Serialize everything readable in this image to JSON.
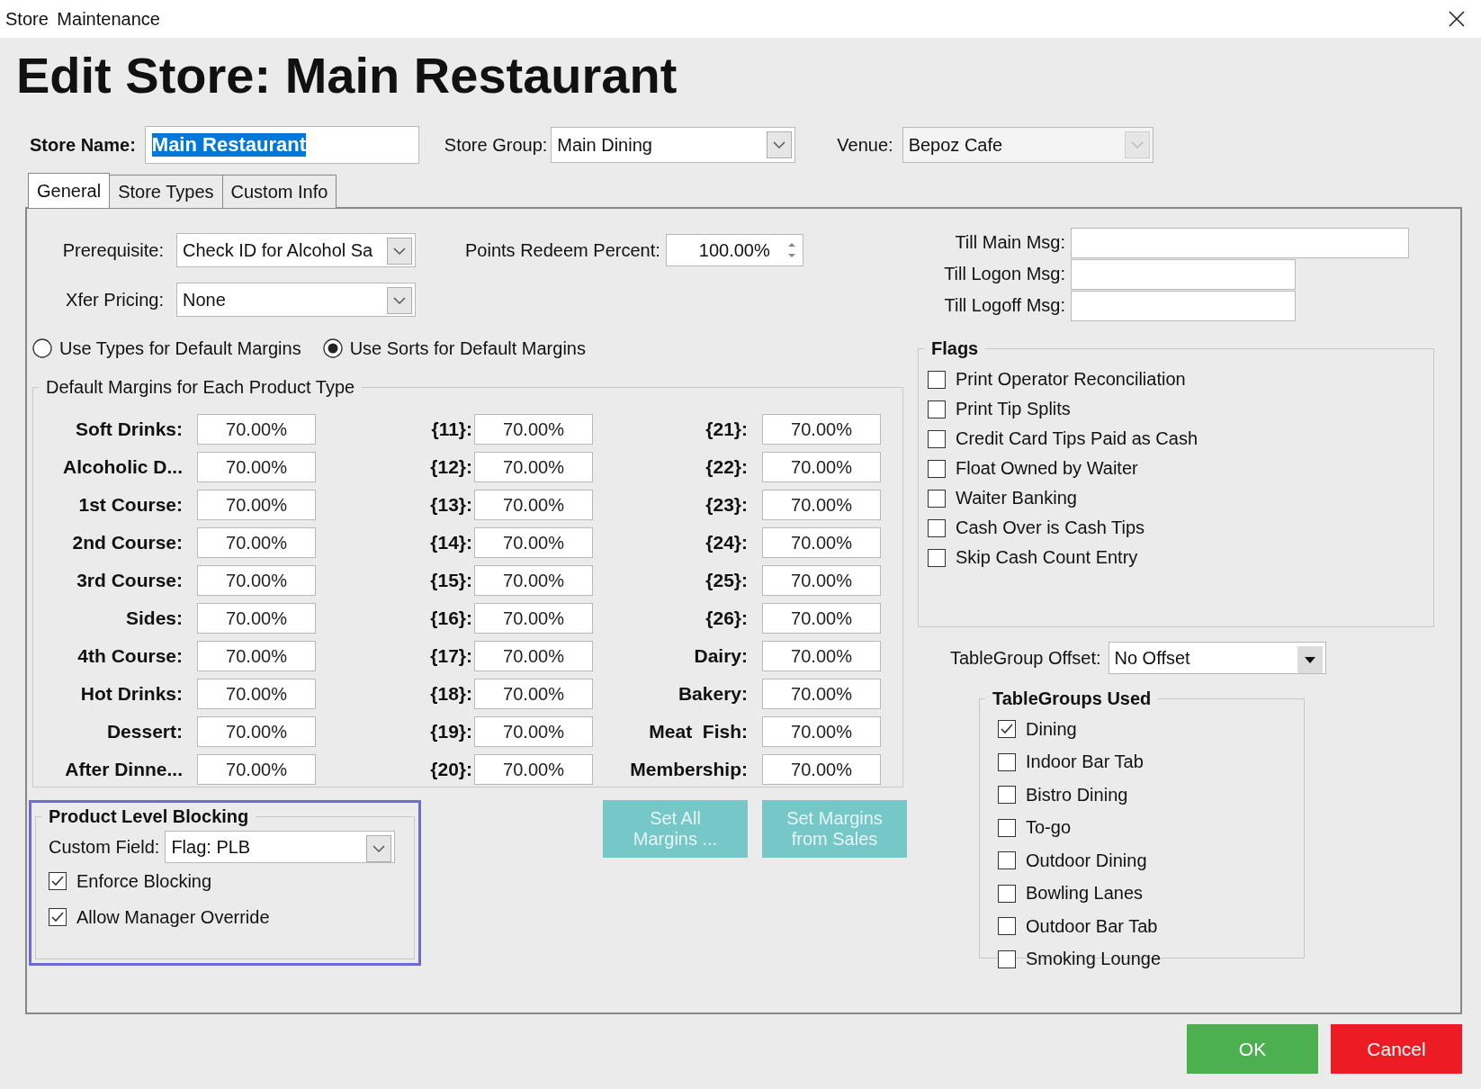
{
  "window": {
    "title": "Store Maintenance"
  },
  "heading": "Edit Store: Main Restaurant",
  "store_name": {
    "label": "Store Name:",
    "value": "Main Restaurant",
    "text_selected": true
  },
  "store_group": {
    "label": "Store Group:",
    "value": "Main Dining"
  },
  "venue": {
    "label": "Venue:",
    "value": "Bepoz Cafe",
    "disabled": true
  },
  "tabs": [
    {
      "label": "General",
      "selected": true
    },
    {
      "label": "Store Types",
      "selected": false
    },
    {
      "label": "Custom Info",
      "selected": false
    }
  ],
  "prerequisite": {
    "label": "Prerequisite:",
    "value": "Check ID for Alcohol Sa"
  },
  "xfer_pricing": {
    "label": "Xfer Pricing:",
    "value": "None"
  },
  "points_redeem": {
    "label": "Points Redeem Percent:",
    "value": "100.00%"
  },
  "margin_source": [
    {
      "label": "Use Types for Default Margins",
      "selected": false
    },
    {
      "label": "Use Sorts for Default Margins",
      "selected": true
    }
  ],
  "margins": {
    "title": "Default Margins for Each Product Type",
    "columns": [
      [
        {
          "label": "Soft Drinks:",
          "value": "70.00%"
        },
        {
          "label": "Alcoholic D...",
          "value": "70.00%"
        },
        {
          "label": "1st Course:",
          "value": "70.00%"
        },
        {
          "label": "2nd Course:",
          "value": "70.00%"
        },
        {
          "label": "3rd Course:",
          "value": "70.00%"
        },
        {
          "label": "Sides:",
          "value": "70.00%"
        },
        {
          "label": "4th Course:",
          "value": "70.00%"
        },
        {
          "label": "Hot Drinks:",
          "value": "70.00%"
        },
        {
          "label": "Dessert:",
          "value": "70.00%"
        },
        {
          "label": "After Dinne...",
          "value": "70.00%"
        }
      ],
      [
        {
          "label": "{11}:",
          "value": "70.00%"
        },
        {
          "label": "{12}:",
          "value": "70.00%"
        },
        {
          "label": "{13}:",
          "value": "70.00%"
        },
        {
          "label": "{14}:",
          "value": "70.00%"
        },
        {
          "label": "{15}:",
          "value": "70.00%"
        },
        {
          "label": "{16}:",
          "value": "70.00%"
        },
        {
          "label": "{17}:",
          "value": "70.00%"
        },
        {
          "label": "{18}:",
          "value": "70.00%"
        },
        {
          "label": "{19}:",
          "value": "70.00%"
        },
        {
          "label": "{20}:",
          "value": "70.00%"
        }
      ],
      [
        {
          "label": "{21}:",
          "value": "70.00%"
        },
        {
          "label": "{22}:",
          "value": "70.00%"
        },
        {
          "label": "{23}:",
          "value": "70.00%"
        },
        {
          "label": "{24}:",
          "value": "70.00%"
        },
        {
          "label": "{25}:",
          "value": "70.00%"
        },
        {
          "label": "{26}:",
          "value": "70.00%"
        },
        {
          "label": "Dairy:",
          "value": "70.00%"
        },
        {
          "label": "Bakery:",
          "value": "70.00%"
        },
        {
          "label": "Meat  Fish:",
          "value": "70.00%"
        },
        {
          "label": "Membership:",
          "value": "70.00%"
        }
      ]
    ]
  },
  "product_level_blocking": {
    "title": "Product Level Blocking",
    "highlighted": true,
    "custom_field": {
      "label": "Custom Field:",
      "value": "Flag: PLB"
    },
    "options": [
      {
        "label": "Enforce Blocking",
        "checked": true
      },
      {
        "label": "Allow Manager Override",
        "checked": true
      }
    ]
  },
  "actions": [
    {
      "lines": [
        "Set All",
        "Margins ..."
      ],
      "disabled": true
    },
    {
      "lines": [
        "Set Margins",
        "from Sales"
      ],
      "disabled": true
    }
  ],
  "till_messages": [
    {
      "label": "Till Main Msg:"
    },
    {
      "label": "Till Logon Msg:"
    },
    {
      "label": "Till Logoff Msg:"
    }
  ],
  "flags": {
    "title": "Flags",
    "items": [
      {
        "label": "Print Operator Reconciliation",
        "checked": false
      },
      {
        "label": "Print Tip Splits",
        "checked": false
      },
      {
        "label": "Credit Card Tips Paid as Cash",
        "checked": false
      },
      {
        "label": "Float Owned by Waiter",
        "checked": false
      },
      {
        "label": "Waiter Banking",
        "checked": false
      },
      {
        "label": "Cash Over is Cash Tips",
        "checked": false
      },
      {
        "label": "Skip Cash Count Entry",
        "checked": false
      }
    ]
  },
  "tablegroup_offset": {
    "label": "TableGroup Offset:",
    "value": "No Offset"
  },
  "tablegroups_used": {
    "title": "TableGroups Used",
    "items": [
      {
        "label": "Dining",
        "checked": true
      },
      {
        "label": "Indoor Bar Tab",
        "checked": false
      },
      {
        "label": "Bistro Dining",
        "checked": false
      },
      {
        "label": "To-go",
        "checked": false
      },
      {
        "label": "Outdoor Dining",
        "checked": false
      },
      {
        "label": "Bowling Lanes",
        "checked": false
      },
      {
        "label": "Outdoor Bar Tab",
        "checked": false
      },
      {
        "label": "Smoking Lounge",
        "checked": false
      }
    ]
  },
  "buttons": [
    {
      "label": "OK",
      "kind": "ok"
    },
    {
      "label": "Cancel",
      "kind": "cancel"
    }
  ]
}
